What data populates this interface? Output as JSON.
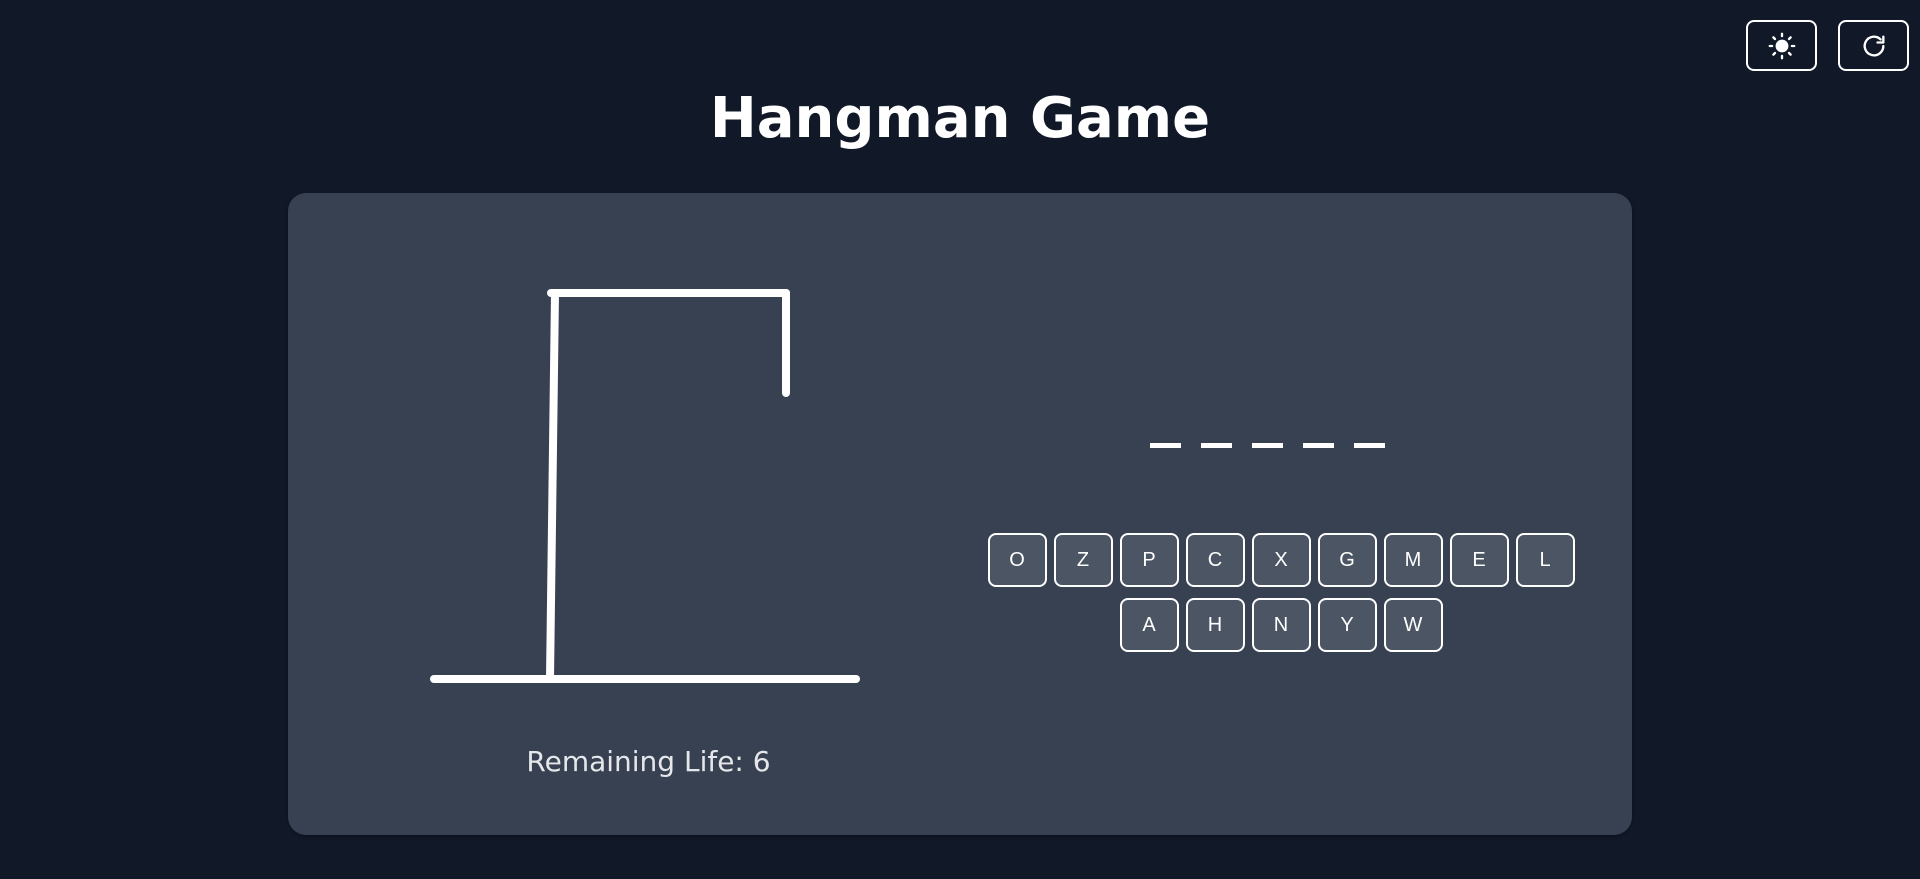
{
  "header": {
    "title": "Hangman Game",
    "theme_toggle_icon": "sun-icon",
    "restart_icon": "refresh-icon"
  },
  "game": {
    "remaining_life_label": "Remaining Life: 6",
    "remaining_life": 6,
    "word_blanks": [
      "",
      "",
      "",
      "",
      ""
    ]
  },
  "keyboard": {
    "row1": [
      "O",
      "Z",
      "P",
      "C",
      "X",
      "G",
      "M",
      "E",
      "L"
    ],
    "row2": [
      "A",
      "H",
      "N",
      "Y",
      "W"
    ]
  },
  "colors": {
    "background": "#111827",
    "card": "#374151",
    "key": "#4b5563",
    "foreground": "#ffffff"
  }
}
